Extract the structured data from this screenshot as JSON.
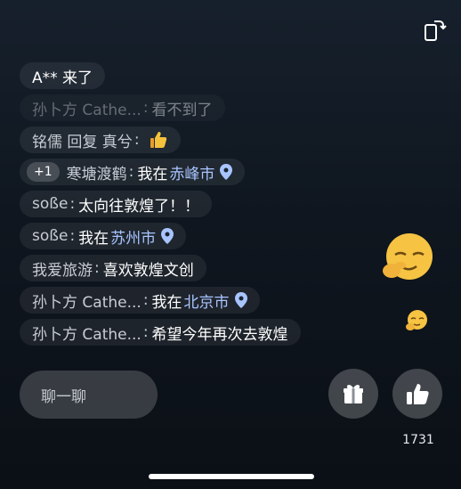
{
  "chat": {
    "messages": [
      {
        "text": "A** 来了"
      },
      {
        "user": "孙卜方 Cathe...",
        "sep": ":",
        "text": "看不到了"
      },
      {
        "user": "铭儒 回复 真兮",
        "sep": ":"
      },
      {
        "badge": "+1",
        "user": "寒塘渡鹤",
        "sep": ":",
        "text": "我在",
        "city": "赤峰市"
      },
      {
        "user": "soße",
        "sep": ":",
        "text": "太向往敦煌了！！"
      },
      {
        "user": "soße",
        "sep": ":",
        "text": "我在",
        "city": "苏州市"
      },
      {
        "user": "我爱旅游",
        "sep": ":",
        "text": "喜欢敦煌文创"
      },
      {
        "user": "孙卜方 Cathe...",
        "sep": ":",
        "text": "我在",
        "city": "北京市"
      },
      {
        "user": "孙卜方 Cathe...",
        "sep": ":",
        "text": "希望今年再次去敦煌"
      }
    ]
  },
  "input": {
    "placeholder": "聊一聊"
  },
  "like": {
    "count": "1731"
  },
  "icons": {
    "rotate": "rotate-screen-icon",
    "gift": "gift-icon",
    "like": "thumbs-up-icon",
    "pin": "location-pin-icon",
    "thumb_emoji": "thumbs-up-emoji-icon",
    "floating_emoji": "smirk-emoji-icon"
  },
  "colors": {
    "city": "#a8c4ff",
    "bubble": "rgba(255,255,255,0.07)"
  }
}
